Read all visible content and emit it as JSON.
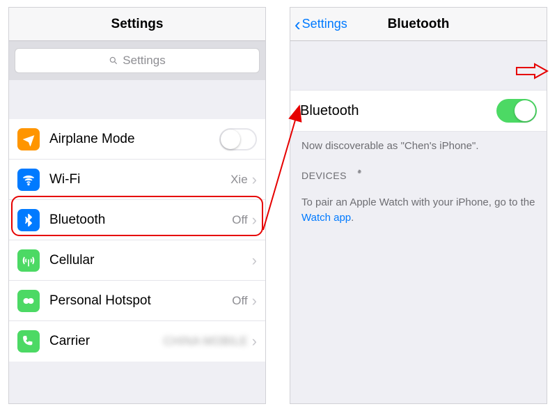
{
  "left": {
    "title": "Settings",
    "search_placeholder": "Settings",
    "rows": {
      "airplane": {
        "label": "Airplane Mode"
      },
      "wifi": {
        "label": "Wi-Fi",
        "value": "Xie"
      },
      "bluetooth": {
        "label": "Bluetooth",
        "value": "Off"
      },
      "cellular": {
        "label": "Cellular"
      },
      "hotspot": {
        "label": "Personal Hotspot",
        "value": "Off"
      },
      "carrier": {
        "label": "Carrier",
        "value": "CHINA MOBILE"
      }
    }
  },
  "right": {
    "back_label": "Settings",
    "title": "Bluetooth",
    "toggle_label": "Bluetooth",
    "discoverable": "Now discoverable as \"Chen's iPhone\".",
    "devices_header": "DEVICES",
    "pair_text_prefix": "To pair an Apple Watch with your iPhone, go to the ",
    "pair_link": "Watch app",
    "pair_text_suffix": "."
  },
  "colors": {
    "orange": "#ff9500",
    "blue": "#007aff",
    "green": "#4cd964",
    "green2": "#34c759"
  }
}
